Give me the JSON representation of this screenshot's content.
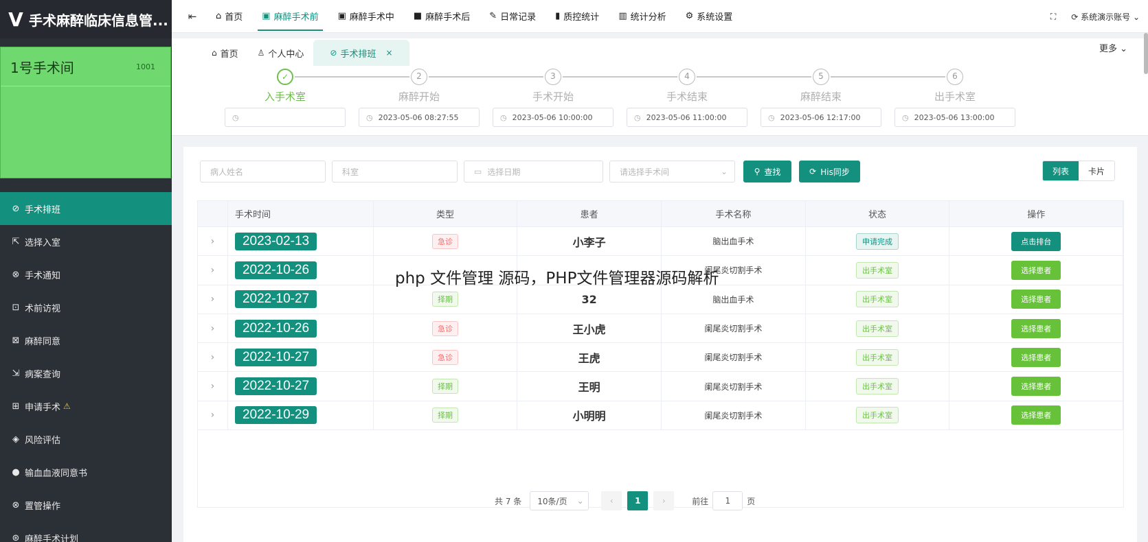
{
  "app": {
    "title": "手术麻醉临床信息管..."
  },
  "room": {
    "name": "1号手术间",
    "code": "1001"
  },
  "sidebar": {
    "items": [
      {
        "label": "手术排班",
        "icon": "⊘",
        "active": true
      },
      {
        "label": "选择入室",
        "icon": "⇱"
      },
      {
        "label": "手术通知",
        "icon": "⊗"
      },
      {
        "label": "术前访视",
        "icon": "⊡"
      },
      {
        "label": "麻醉同意",
        "icon": "⊠"
      },
      {
        "label": "病案查询",
        "icon": "⇲"
      },
      {
        "label": "申请手术",
        "icon": "⊞"
      },
      {
        "label": "风险评估",
        "icon": "◈"
      },
      {
        "label": "输血血液同意书",
        "icon": "●"
      },
      {
        "label": "置管操作",
        "icon": "⊗"
      },
      {
        "label": "麻醉手术计划",
        "icon": "⊛"
      }
    ]
  },
  "topnav": {
    "items": [
      {
        "label": "首页",
        "icon": "⌂"
      },
      {
        "label": "麻醉手术前",
        "icon": "▣",
        "active": true
      },
      {
        "label": "麻醉手术中",
        "icon": "▣"
      },
      {
        "label": "麻醉手术后",
        "icon": "■"
      },
      {
        "label": "日常记录",
        "icon": "✎"
      },
      {
        "label": "质控统计",
        "icon": "▮"
      },
      {
        "label": "统计分析",
        "icon": "▥"
      },
      {
        "label": "系统设置",
        "icon": "⚙"
      }
    ],
    "account": "系统演示账号"
  },
  "tabs": {
    "items": [
      {
        "label": "首页",
        "icon": "⌂"
      },
      {
        "label": "个人中心",
        "icon": "♙"
      },
      {
        "label": "手术排班",
        "icon": "⊘",
        "active": true
      }
    ],
    "more": "更多"
  },
  "steps": [
    {
      "num": "✓",
      "title": "入手术室",
      "time": "",
      "done": true
    },
    {
      "num": "2",
      "title": "麻醉开始",
      "time": "2023-05-06 08:27:55"
    },
    {
      "num": "3",
      "title": "手术开始",
      "time": "2023-05-06 10:00:00"
    },
    {
      "num": "4",
      "title": "手术结束",
      "time": "2023-05-06 11:00:00"
    },
    {
      "num": "5",
      "title": "麻醉结束",
      "time": "2023-05-06 12:17:00"
    },
    {
      "num": "6",
      "title": "出手术室",
      "time": "2023-05-06 13:00:00"
    }
  ],
  "filters": {
    "patient_placeholder": "病人姓名",
    "dept_placeholder": "科室",
    "date_placeholder": "选择日期",
    "room_placeholder": "请选择手术间",
    "search_label": "查找",
    "sync_label": "His同步",
    "view_list": "列表",
    "view_card": "卡片"
  },
  "table": {
    "headers": [
      "手术时间",
      "类型",
      "患者",
      "手术名称",
      "状态",
      "操作"
    ],
    "rows": [
      {
        "date": "2023-02-13",
        "type": "急诊",
        "type_kind": "urgent",
        "patient": "小李子",
        "surgery": "脑出血手术",
        "status": "申请完成",
        "status_kind": "done",
        "action": "点击排台",
        "action_kind": "teal"
      },
      {
        "date": "2022-10-26",
        "type": "",
        "type_kind": "none",
        "patient": "",
        "surgery": "阑尾炎切割手术",
        "status": "出手术室",
        "status_kind": "out",
        "action": "选择患者",
        "action_kind": "green"
      },
      {
        "date": "2022-10-27",
        "type": "择期",
        "type_kind": "elective",
        "patient": "32",
        "surgery": "脑出血手术",
        "status": "出手术室",
        "status_kind": "out",
        "action": "选择患者",
        "action_kind": "green"
      },
      {
        "date": "2022-10-26",
        "type": "急诊",
        "type_kind": "urgent",
        "patient": "王小虎",
        "surgery": "阑尾炎切割手术",
        "status": "出手术室",
        "status_kind": "out",
        "action": "选择患者",
        "action_kind": "green"
      },
      {
        "date": "2022-10-27",
        "type": "急诊",
        "type_kind": "urgent",
        "patient": "王虎",
        "surgery": "阑尾炎切割手术",
        "status": "出手术室",
        "status_kind": "out",
        "action": "选择患者",
        "action_kind": "green"
      },
      {
        "date": "2022-10-27",
        "type": "择期",
        "type_kind": "elective",
        "patient": "王明",
        "surgery": "阑尾炎切割手术",
        "status": "出手术室",
        "status_kind": "out",
        "action": "选择患者",
        "action_kind": "green"
      },
      {
        "date": "2022-10-29",
        "type": "择期",
        "type_kind": "elective",
        "patient": "小明明",
        "surgery": "阑尾炎切割手术",
        "status": "出手术室",
        "status_kind": "out",
        "action": "选择患者",
        "action_kind": "green"
      }
    ]
  },
  "pager": {
    "total": "共 7 条",
    "page_size": "10条/页",
    "current": "1",
    "goto_label": "前往",
    "goto_value": "1",
    "page_unit": "页"
  },
  "overlay_text": "php 文件管理 源码，PHP文件管理器源码解析",
  "colors": {
    "accent": "#13917e",
    "success": "#67c23a",
    "danger": "#f56c6c",
    "room_card": "#6fd86f"
  }
}
